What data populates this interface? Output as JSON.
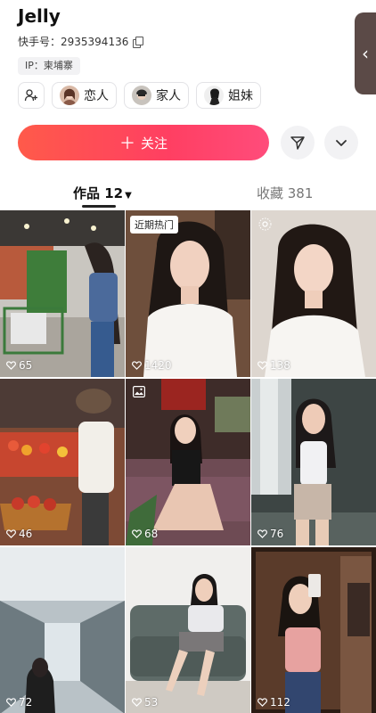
{
  "profile": {
    "name": "Jelly",
    "kuaishou_id_label": "快手号：2935394136",
    "ip_label": "IP：柬埔寨"
  },
  "relation_chips": [
    {
      "label": "恋人"
    },
    {
      "label": "家人"
    },
    {
      "label": "姐妹"
    }
  ],
  "actions": {
    "follow_label": "关注",
    "follow_plus": "＋"
  },
  "tabs": {
    "works_label": "作品",
    "works_count": "12",
    "favorites_label": "收藏 381"
  },
  "posts": [
    {
      "likes": "65"
    },
    {
      "likes": "1420",
      "badge": "近期热门"
    },
    {
      "likes": "138"
    },
    {
      "likes": "46"
    },
    {
      "likes": "68"
    },
    {
      "likes": "76"
    },
    {
      "likes": "72"
    },
    {
      "likes": "53"
    },
    {
      "likes": "112"
    }
  ],
  "colors": {
    "follow_gradient_start": "#ff5a4a",
    "follow_gradient_end": "#ff4c7b",
    "side_handle": "#5b4a47"
  },
  "icons": {
    "copy": "copy-icon",
    "add_friend": "add-person-icon",
    "share": "share-arrow-icon",
    "more": "chevron-down-icon",
    "likes": "heart-outline-icon"
  }
}
